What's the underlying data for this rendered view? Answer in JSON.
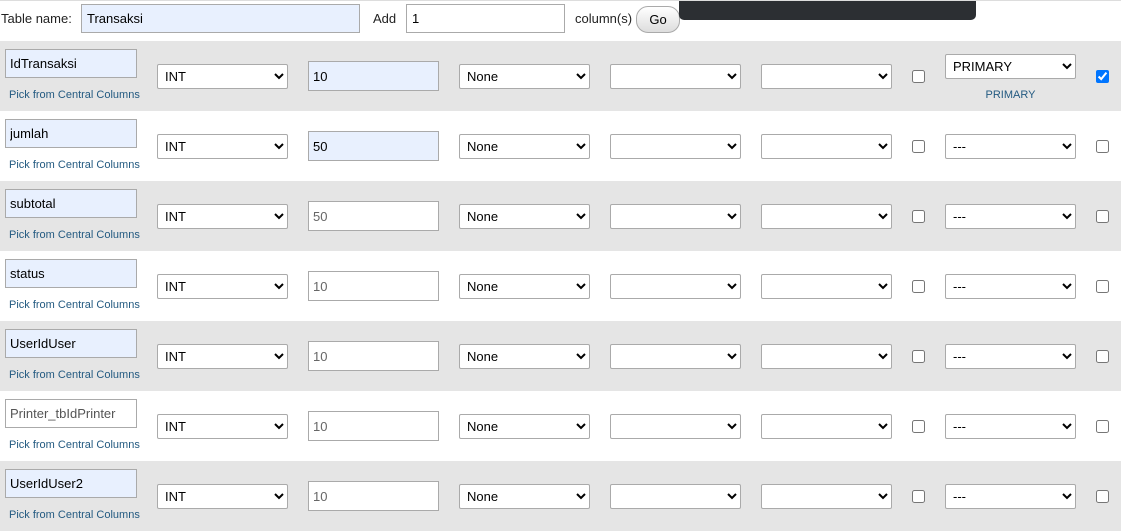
{
  "header": {
    "table_name_label": "Table name:",
    "table_name_value": "Transaksi",
    "add_label": "Add",
    "add_value": "1",
    "columns_label": "column(s)",
    "go_label": "Go"
  },
  "pick_link_label": "Pick from Central Columns",
  "columns": [
    {
      "name": "IdTransaksi",
      "name_placeholder": "",
      "type": "INT",
      "length": "10",
      "length_placeholder": "",
      "default": "None",
      "collation": "",
      "attributes": "",
      "null": false,
      "index": "PRIMARY",
      "index_label": "PRIMARY",
      "ai": true
    },
    {
      "name": "jumlah",
      "name_placeholder": "",
      "type": "INT",
      "length": "50",
      "length_placeholder": "",
      "default": "None",
      "collation": "",
      "attributes": "",
      "null": false,
      "index": "---",
      "index_label": "",
      "ai": false
    },
    {
      "name": "subtotal",
      "name_placeholder": "",
      "type": "INT",
      "length": "",
      "length_placeholder": "50",
      "default": "None",
      "collation": "",
      "attributes": "",
      "null": false,
      "index": "---",
      "index_label": "",
      "ai": false
    },
    {
      "name": "status",
      "name_placeholder": "",
      "type": "INT",
      "length": "",
      "length_placeholder": "10",
      "default": "None",
      "collation": "",
      "attributes": "",
      "null": false,
      "index": "---",
      "index_label": "",
      "ai": false
    },
    {
      "name": "UserIdUser",
      "name_placeholder": "",
      "type": "INT",
      "length": "",
      "length_placeholder": "10",
      "default": "None",
      "collation": "",
      "attributes": "",
      "null": false,
      "index": "---",
      "index_label": "",
      "ai": false
    },
    {
      "name": "",
      "name_placeholder": "Printer_tbIdPrinter",
      "type": "INT",
      "length": "",
      "length_placeholder": "10",
      "default": "None",
      "collation": "",
      "attributes": "",
      "null": false,
      "index": "---",
      "index_label": "",
      "ai": false
    },
    {
      "name": "UserIdUser2",
      "name_placeholder": "",
      "type": "INT",
      "length": "",
      "length_placeholder": "10",
      "default": "None",
      "collation": "",
      "attributes": "",
      "null": false,
      "index": "---",
      "index_label": "",
      "ai": false
    }
  ]
}
